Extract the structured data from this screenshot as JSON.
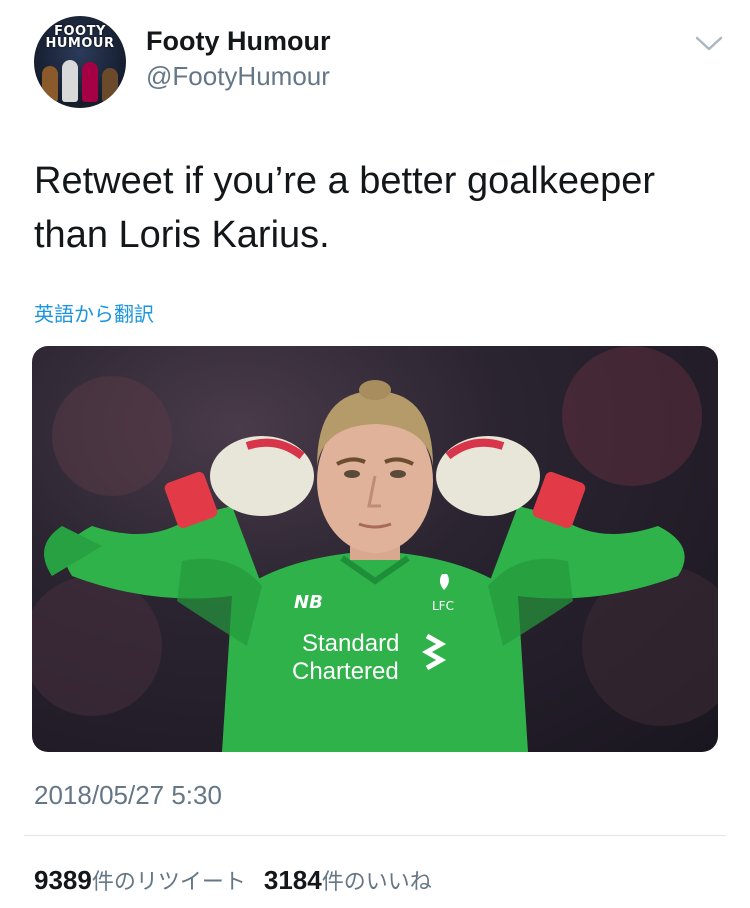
{
  "author": {
    "avatar_logo_line1": "FOOTY",
    "avatar_logo_line2": "HUMOUR",
    "display_name": "Footy Humour",
    "handle": "@FootyHumour"
  },
  "tweet": {
    "text_line1": "Retweet if you’re a better goalkeeper",
    "text_line2": "than Loris Karius.",
    "translate_link": "英語から翻訳"
  },
  "media": {
    "description_icon": "goalkeeper-photo",
    "shirt_sponsor_line1": "Standard",
    "shirt_sponsor_line2": "Chartered",
    "shirt_crest": "LFC"
  },
  "meta": {
    "timestamp": "2018/05/27 5:30",
    "retweet_count": "9389",
    "retweet_label": "件のリツイート",
    "like_count": "3184",
    "like_label": "件のいいね"
  },
  "colors": {
    "link": "#1b95e0",
    "secondary_text": "#657786",
    "primary_text": "#14171a",
    "divider": "#e1e8ed",
    "kit_green": "#2fb24a"
  },
  "icons": {
    "menu_caret": "chevron-down-icon"
  }
}
